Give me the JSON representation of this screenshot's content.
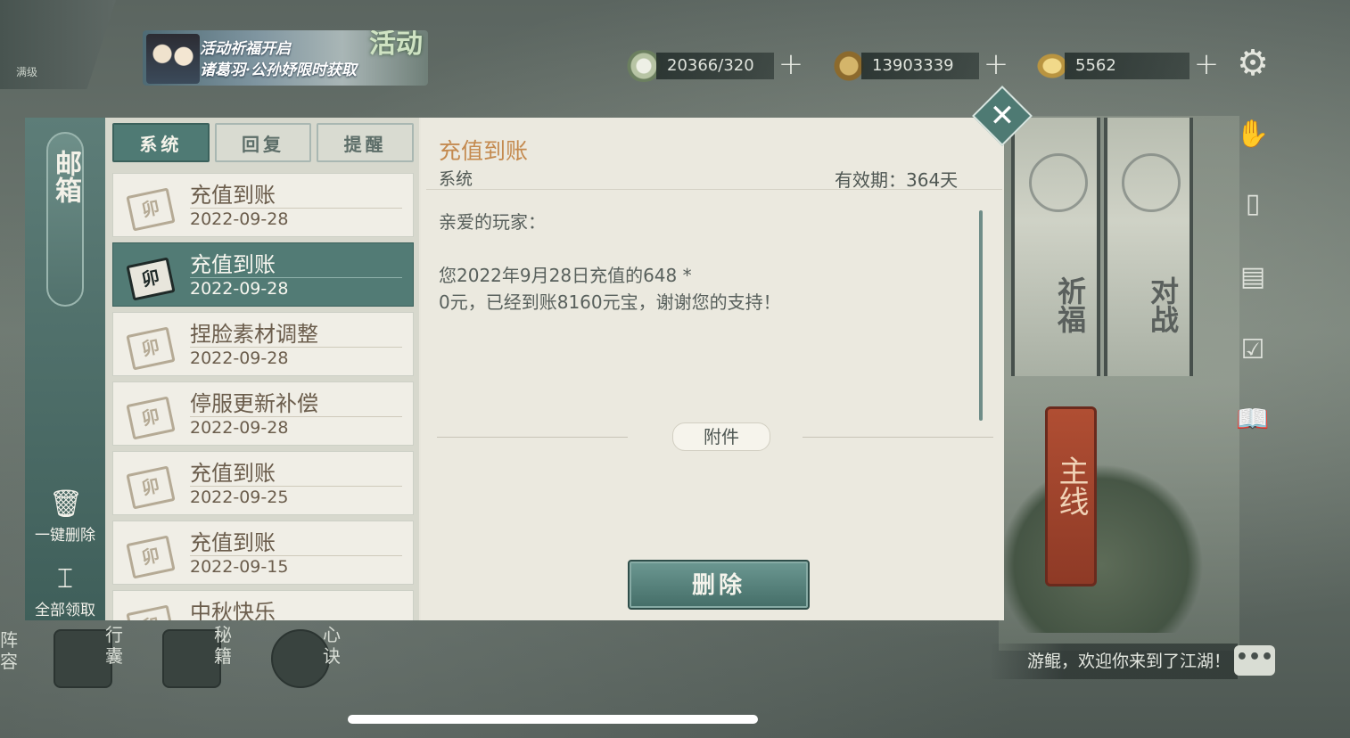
{
  "top": {
    "banner_line1": "活动祈福开启",
    "banner_line2": "诸葛羽·公孙妤限时获取",
    "banner_big": "活动",
    "level_text": "满级",
    "resources": [
      {
        "icon": "bun-icon",
        "value": "20366/320"
      },
      {
        "icon": "coin-icon",
        "value": "13903339"
      },
      {
        "icon": "ingot-icon",
        "value": "5562"
      }
    ],
    "plus_glyph": "+"
  },
  "mail": {
    "title": "邮箱",
    "tabs": [
      "系统",
      "回复",
      "提醒"
    ],
    "active_tab": 0,
    "items": [
      {
        "title": "充值到账",
        "date": "2022-09-28"
      },
      {
        "title": "充值到账",
        "date": "2022-09-28"
      },
      {
        "title": "捏脸素材调整",
        "date": "2022-09-28"
      },
      {
        "title": "停服更新补偿",
        "date": "2022-09-28"
      },
      {
        "title": "充值到账",
        "date": "2022-09-25"
      },
      {
        "title": "充值到账",
        "date": "2022-09-15"
      },
      {
        "title": "中秋快乐",
        "date": ""
      }
    ],
    "selected_index": 1,
    "delete_all": "一键删除",
    "claim_all": "全部领取",
    "detail": {
      "title": "充值到账",
      "sender": "系统",
      "expiry": "有效期：364天",
      "body": "亲爱的玩家：\n\n您2022年9月28日充值的648 *\n0元，已经到账8160元宝，谢谢您的支持！",
      "attachment_label": "附件",
      "delete_button": "删除"
    }
  },
  "right": {
    "scroll_left": "祈福",
    "scroll_right": "对战",
    "main_quest": "主线"
  },
  "bottom": {
    "nav": [
      {
        "label": "行囊"
      },
      {
        "label": "秘籍"
      },
      {
        "label": "心诀"
      }
    ],
    "left_edge": "阵容",
    "welcome": "游鲲，欢迎你来到了江湖！",
    "chat_glyph": "•••"
  }
}
